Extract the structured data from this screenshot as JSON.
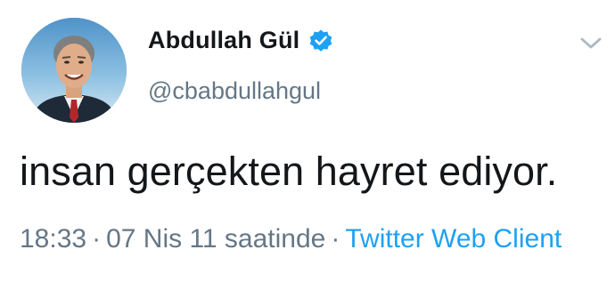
{
  "tweet": {
    "display_name": "Abdullah Gül",
    "handle": "@cbabdullahgul",
    "text": "insan gerçekten hayret ediyor.",
    "time": "18:33",
    "date": "07 Nis 11 saatinde",
    "separator": "·",
    "source": "Twitter Web Client"
  },
  "icons": {
    "verified": "verified-badge-icon",
    "menu": "chevron-down-icon"
  },
  "colors": {
    "name_text": "#14171a",
    "muted_text": "#657786",
    "link_blue": "#1da1f2",
    "verified_blue": "#1da1f2"
  }
}
